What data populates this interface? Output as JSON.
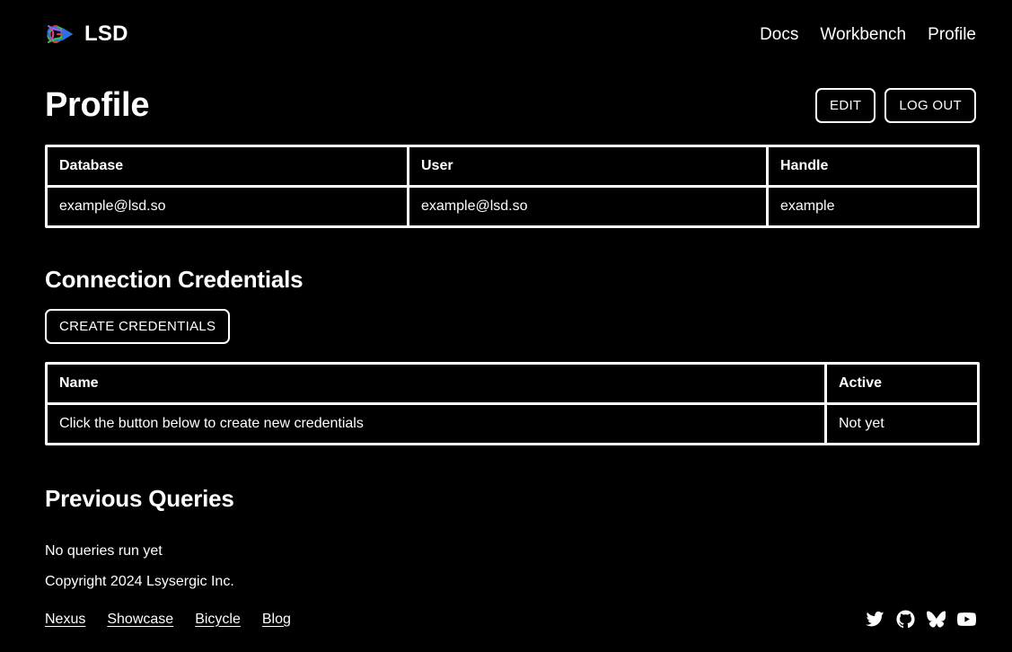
{
  "theme": {
    "background": "#000000",
    "foreground": "#ffffff",
    "logo_colors": [
      "#e03b3b",
      "#2ec04f",
      "#2f6fe0",
      "#9b5de5",
      "#e03b9b"
    ]
  },
  "header": {
    "brand": {
      "logo_icon": "lsd-molecule-logo-icon",
      "name": "LSD"
    },
    "nav": [
      {
        "label": "Docs"
      },
      {
        "label": "Workbench"
      },
      {
        "label": "Profile"
      }
    ]
  },
  "main": {
    "page_title": "Profile",
    "actions": [
      {
        "label": "EDIT"
      },
      {
        "label": "LOG OUT"
      }
    ],
    "profile_table": {
      "columns": [
        "Database",
        "User",
        "Handle"
      ],
      "rows": [
        [
          "example@lsd.so",
          "example@lsd.so",
          "example"
        ]
      ]
    },
    "credentials": {
      "heading": "Connection Credentials",
      "create_button": "CREATE CREDENTIALS",
      "table": {
        "columns": [
          "Name",
          "Active"
        ],
        "rows": [
          [
            "Click the button below to create new credentials",
            "Not yet"
          ]
        ]
      }
    },
    "queries": {
      "heading": "Previous Queries",
      "empty_text": "No queries run yet"
    }
  },
  "footer": {
    "copyright": "Copyright 2024 Lsysergic Inc.",
    "links": [
      {
        "label": "Nexus"
      },
      {
        "label": "Showcase"
      },
      {
        "label": "Bicycle"
      },
      {
        "label": "Blog"
      }
    ],
    "social": [
      {
        "icon": "twitter-icon"
      },
      {
        "icon": "github-icon"
      },
      {
        "icon": "bluesky-icon"
      },
      {
        "icon": "youtube-icon"
      }
    ]
  }
}
